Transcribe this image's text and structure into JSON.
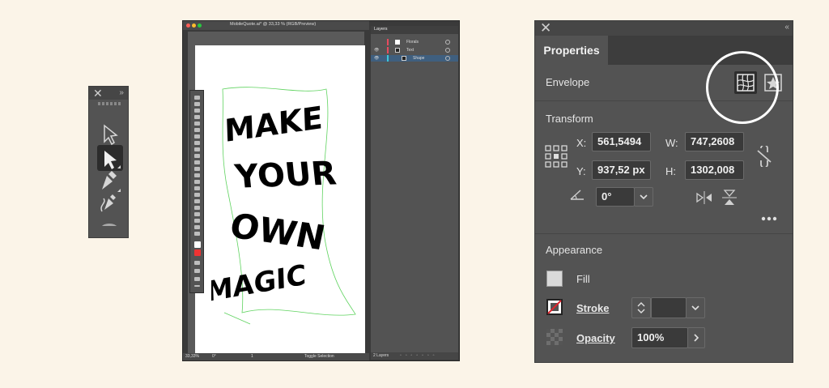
{
  "ai_window": {
    "title": "MobileQuote.ai* @ 33,33 % (RGB/Preview)",
    "zoom": "33,33%",
    "page_field": "0°",
    "artboard_nav": "1",
    "status": "Toggle Selection",
    "art_lines": [
      "MAKE",
      "YOUR",
      "OWN",
      "MAGIC"
    ]
  },
  "layers": {
    "tab": "Layers",
    "rows": [
      {
        "label": "Florals",
        "color": "#e84a5f"
      },
      {
        "label": "Text",
        "color": "#e84a5f"
      },
      {
        "label": "Shape",
        "color": "#3cc7d8"
      }
    ],
    "footer": "2 Layers"
  },
  "properties": {
    "tab": "Properties",
    "envelope": {
      "label": "Envelope"
    },
    "transform": {
      "label": "Transform",
      "x_label": "X:",
      "x_value": "561,5494",
      "y_label": "Y:",
      "y_value": "937,52 px",
      "w_label": "W:",
      "w_value": "747,2608",
      "h_label": "H:",
      "h_value": "1302,008",
      "angle_value": "0°"
    },
    "appearance": {
      "label": "Appearance",
      "fill_label": "Fill",
      "stroke_label": "Stroke",
      "opacity_label": "Opacity",
      "opacity_value": "100%"
    }
  },
  "colors": {
    "background": "#fbf4e8",
    "panel": "#535353",
    "highlight_circle": "#ffffff",
    "selection_green": "#5fd35f"
  }
}
